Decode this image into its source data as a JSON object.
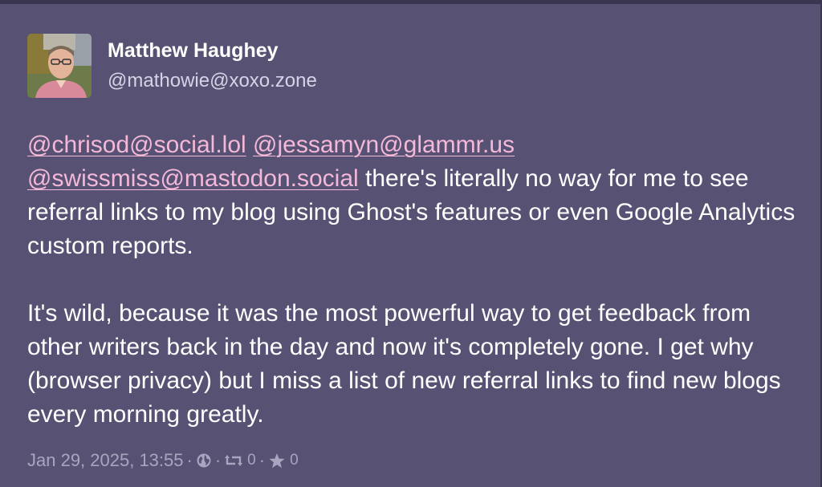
{
  "author": {
    "display_name": "Matthew Haughey",
    "handle": "@mathowie@xoxo.zone"
  },
  "post": {
    "mentions": [
      "@chrisod@social.lol",
      "@jessamyn@glammr.us",
      "@swissmiss@mastodon.social"
    ],
    "paragraph1_text": " there's literally no way for me to see referral links to my blog using Ghost's features or even Google Analytics custom reports.",
    "paragraph2_text": "It's wild, because it was the most powerful way to get feedback from other writers back in the day and now it's completely gone. I get why (browser privacy) but I miss a list of new referral links to find new blogs every morning greatly."
  },
  "meta": {
    "timestamp": "Jan 29, 2025, 13:55",
    "separator": "·",
    "visibility_icon": "globe-icon",
    "boost_icon": "boost-icon",
    "boost_count": "0",
    "favourite_icon": "star-icon",
    "favourite_count": "0"
  },
  "colors": {
    "background": "#575273",
    "mention": "#f4b8d8",
    "meta_text": "#a9a4bf",
    "handle_text": "#d7d3e6"
  }
}
